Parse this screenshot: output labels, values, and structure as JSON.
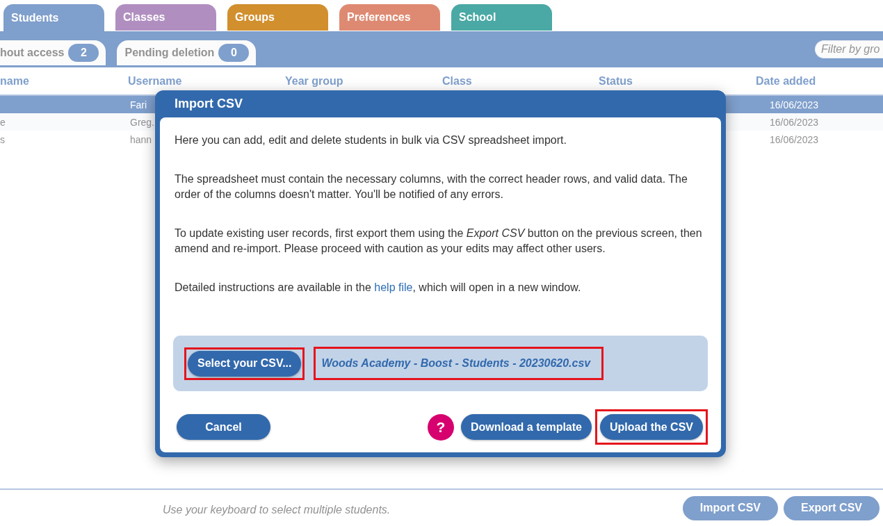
{
  "tabs": [
    {
      "label": "Students",
      "color": "#7f9fcc",
      "selected": true
    },
    {
      "label": "Classes",
      "color": "#b08fc0",
      "selected": false
    },
    {
      "label": "Groups",
      "color": "#d18f2e",
      "selected": false
    },
    {
      "label": "Preferences",
      "color": "#de8a72",
      "selected": false
    },
    {
      "label": "School",
      "color": "#4aa9a4",
      "selected": false
    }
  ],
  "subtabs": [
    {
      "label": "hout access",
      "count": "2",
      "selected": false
    },
    {
      "label": "Pending deletion",
      "count": "0",
      "selected": false
    }
  ],
  "filter": {
    "placeholder": "Filter by gro"
  },
  "table": {
    "columns": [
      "name",
      "Username",
      "Year group",
      "Class",
      "Status",
      "Date added"
    ],
    "rows": [
      {
        "selected": true,
        "username": "Fari",
        "date_added": "16/06/2023"
      },
      {
        "selected": false,
        "name": "e",
        "username": "Greg.",
        "date_added": "16/06/2023"
      },
      {
        "selected": false,
        "name": "s",
        "username": "hann",
        "date_added": "16/06/2023"
      }
    ]
  },
  "footer": {
    "hint": "Use your keyboard to select multiple students.",
    "buttons": [
      "Import CSV",
      "Export CSV"
    ]
  },
  "dialog": {
    "title": "Import CSV",
    "paragraphs": [
      {
        "text": "Here you can add, edit and delete students in bulk via CSV spreadsheet import."
      },
      {
        "text": "The spreadsheet must contain the necessary columns, with the correct header rows, and valid data. The order of the columns doesn't matter. You'll be notified of any errors."
      },
      {
        "text": "To update existing user records, first export them using the *Export CSV* button on the previous screen, then amend and re-import. Please proceed with caution as your edits may affect other users."
      },
      {
        "text": "Detailed instructions are available in the ",
        "link": "help file",
        "after": ", which will open in a new window."
      }
    ],
    "file_picker": {
      "button": {
        "label": "Select your CSV...",
        "highlighted": true
      },
      "file_name": {
        "text": "Woods Academy - Boost - Students - 20230620.csv",
        "highlighted": true
      }
    },
    "actions_left": [
      {
        "kind": "button",
        "label": "Cancel",
        "highlighted": false
      }
    ],
    "actions_right": [
      {
        "kind": "help",
        "label": "?",
        "highlighted": false
      },
      {
        "kind": "button",
        "label": "Download a template",
        "highlighted": false
      },
      {
        "kind": "button",
        "label": "Upload the CSV",
        "highlighted": true
      }
    ]
  }
}
